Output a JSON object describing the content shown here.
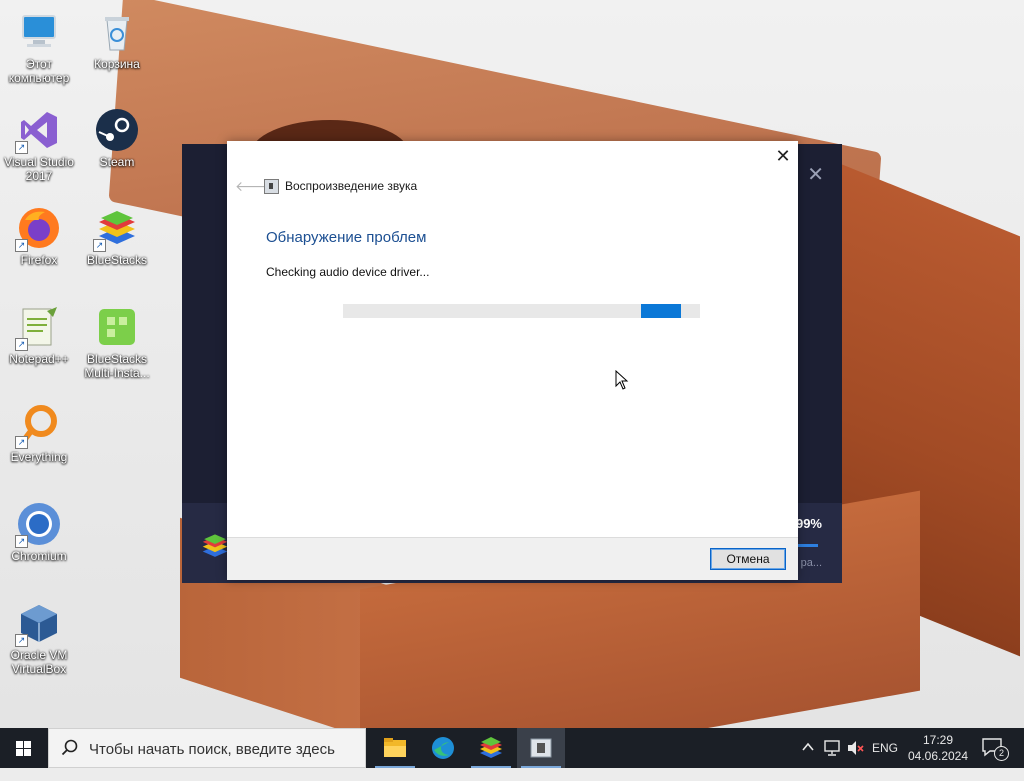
{
  "desktop": {
    "icons": [
      {
        "label": "Этот компьютер",
        "icon": "computer-icon"
      },
      {
        "label": "Корзина",
        "icon": "recycle-bin-icon"
      },
      {
        "label": "Visual Studio 2017",
        "icon": "visual-studio-icon"
      },
      {
        "label": "Steam",
        "icon": "steam-icon"
      },
      {
        "label": "Firefox",
        "icon": "firefox-icon"
      },
      {
        "label": "BlueStacks",
        "icon": "bluestacks-icon"
      },
      {
        "label": "Notepad++",
        "icon": "notepadpp-icon"
      },
      {
        "label": "BlueStacks Multi-Insta...",
        "icon": "bluestacks-multi-icon"
      },
      {
        "label": "Everything",
        "icon": "everything-icon"
      },
      {
        "label": "Chromium",
        "icon": "chromium-icon"
      },
      {
        "label": "Oracle VM VirtualBox",
        "icon": "virtualbox-icon"
      }
    ]
  },
  "background_window": {
    "percent": "99%",
    "sub_text": "ра..."
  },
  "dialog": {
    "title": "Воспроизведение звука",
    "heading": "Обнаружение проблем",
    "status": "Checking audio device driver...",
    "cancel_label": "Отмена",
    "progress_indeterminate": true
  },
  "taskbar": {
    "search_placeholder": "Чтобы начать поиск, введите здесь",
    "apps": [
      "file-explorer-icon",
      "edge-icon",
      "bluestacks-icon",
      "troubleshooter-icon"
    ],
    "language": "ENG",
    "time": "17:29",
    "date": "04.06.2024",
    "notification_count": "2"
  },
  "colors": {
    "accent": "#0b78d7",
    "heading": "#1c4f92",
    "taskbar": "#1b1f26"
  }
}
